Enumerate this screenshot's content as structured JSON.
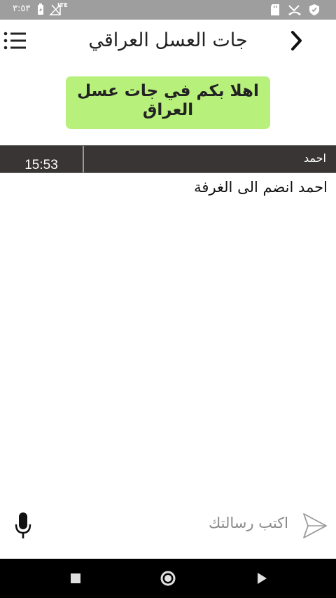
{
  "status_bar": {
    "time": "٣:٥٣",
    "network": "LTE",
    "icons": [
      "battery-icon",
      "signal-icon",
      "sd-card-icon",
      "missed-call-icon",
      "shield-icon"
    ]
  },
  "header": {
    "title": "جات العسل العراقي",
    "menu_icon": "menu-icon",
    "back_icon": "chevron-right-icon"
  },
  "welcome": {
    "text": "اهلا بكم في جات عسل العراق",
    "color": "#b7f07b"
  },
  "messages": [
    {
      "sender": "احمد",
      "time": "15:53",
      "text": "احمد انضم الى الغرفة"
    }
  ],
  "composer": {
    "placeholder": "اكتب رسالتك",
    "mic_icon": "mic-icon",
    "send_icon": "send-icon"
  },
  "nav_bar": {
    "buttons": [
      "recents-square",
      "home-circle",
      "back-triangle"
    ]
  },
  "colors": {
    "status_bar": "#9e9e9e",
    "message_header": "#3a3535",
    "nav_bar": "#000000"
  }
}
